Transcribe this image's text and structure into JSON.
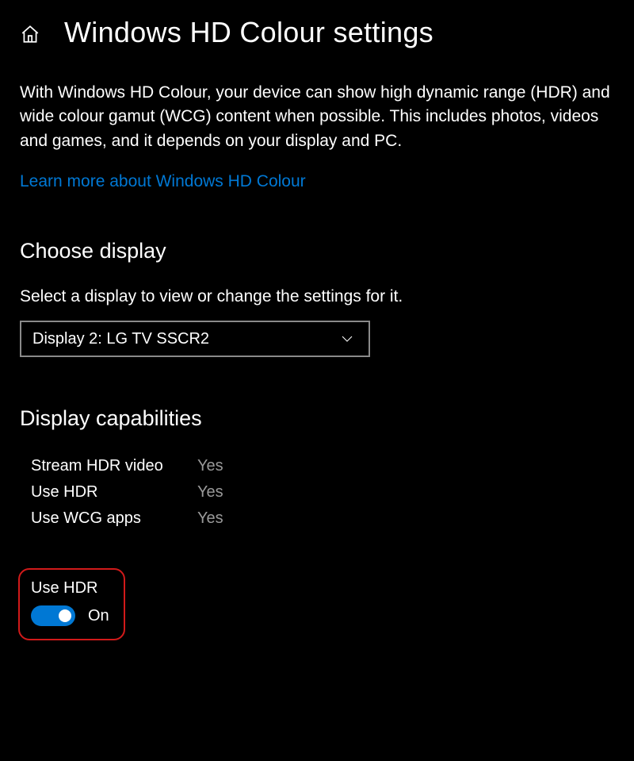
{
  "header": {
    "title": "Windows HD Colour settings"
  },
  "description": "With Windows HD Colour, your device can show high dynamic range (HDR) and wide colour gamut (WCG) content when possible. This includes photos, videos and games, and it depends on your display and PC.",
  "learn_more_link": "Learn more about Windows HD Colour",
  "choose_display": {
    "heading": "Choose display",
    "subtext": "Select a display to view or change the settings for it.",
    "selected": "Display 2: LG TV SSCR2"
  },
  "display_capabilities": {
    "heading": "Display capabilities",
    "rows": [
      {
        "label": "Stream HDR video",
        "value": "Yes"
      },
      {
        "label": "Use HDR",
        "value": "Yes"
      },
      {
        "label": "Use WCG apps",
        "value": "Yes"
      }
    ]
  },
  "use_hdr_toggle": {
    "label": "Use HDR",
    "state": "On"
  }
}
